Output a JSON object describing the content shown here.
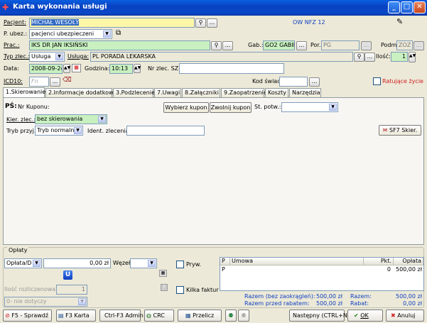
{
  "window": {
    "title": "Karta wykonania usługi",
    "minimize": "_",
    "maximize": "□",
    "close": "✕"
  },
  "header": {
    "pacjent_label": "Pacjent:",
    "pacjent_value": "MICHAŁ WESOŁY",
    "ow_label": "OW NFZ 12",
    "pubezp_label": "P. ubez.:",
    "pubezp_value": "pacjenci ubezpieczeni",
    "prac_label": "Prac.:",
    "prac_value": "IKS DR JAN IKSIŃSKI",
    "gab_label": "Gab.:",
    "gab_value": "GO2 GABIN",
    "por_label": "Por.",
    "por_value": "PG",
    "podm_label": "Podm.",
    "podm_value": "ZOZ",
    "typ_label": "Typ zlec.:",
    "typ_value": "Usługa",
    "usluga_label": "Usługa:",
    "usluga_value": "PL PORADA LEKARSKA",
    "ilosc_label": "Ilość:",
    "ilosc_value": "1",
    "data_label": "Data:",
    "data_value": "2008-09-24",
    "godzina_label": "Godzina:",
    "godzina_value": "10:13",
    "nrzlec_label": "Nr zlec. SZ:",
    "icd_label": "ICD10:",
    "icd_placeholder": "Fn",
    "kodswiad_label": "Kod świad.",
    "ratujace_label": "Ratujące życie",
    "dots": "..."
  },
  "tabs": [
    "1.Skierowanie",
    "2.Informacje dodatkowe",
    "3.Podzlecenie",
    "7.Uwagi",
    "8.Załączniki",
    "9.Zaopatrzenie",
    "Koszty",
    "Narzędzia"
  ],
  "skierowanie": {
    "ps_label": "PŚ:",
    "nrkuponu_label": "Nr Kuponu:",
    "wybierz_btn": "Wybierz kupon",
    "zwolnij_btn": "Zwolnij kupon",
    "stpotw_label": "St. potw.:",
    "kier_label": "Kier. zlec.:",
    "kier_value": "bez skierowania",
    "tryb_label": "Tryb przyj.:",
    "tryb_value": "Tryb normalny",
    "ident_label": "Ident. zlecenia:",
    "sf7_btn": "SF7 Skier."
  },
  "oplaty": {
    "group_label": "Opłaty",
    "typ_value": "Opłata/D",
    "kwota_value": "0,00 zł",
    "wezel_label": "Węzeł:",
    "u_btn": "U",
    "prywatnie_label": "Pryw.",
    "ilosc_rozl_label": "Ilość rozliczenowa:",
    "ilosc_rozl_value": "1",
    "nie_dotyczy": "0- nie dotyczy",
    "kilka_faktur_label": "Kilka faktur"
  },
  "grid": {
    "headers": [
      "P",
      "Umowa",
      "Pkt.",
      "Opłata"
    ],
    "row": {
      "p": "P",
      "umowa": "",
      "pkt": "0",
      "oplata": "500,00 zł"
    }
  },
  "totals": {
    "bez_zaokr_label": "Razem (bez zaokrągleń):",
    "bez_zaokr_value": "500,00 zł",
    "przed_rabatem_label": "Razem przed rabatem:",
    "przed_rabatem_value": "500,00 zł",
    "razem_label": "Razem:",
    "razem_value": "500,00 zł",
    "rabat_label": "Rabat:",
    "rabat_value": "0,00 zł"
  },
  "footer": {
    "f5": "F5 - Sprawdź",
    "f3": "F3 Karta",
    "ctrlf3": "Ctrl-F3 Admin",
    "crc": "CRC",
    "przelicz": "Przelicz",
    "nastepny": "Następny (CTRL+N)",
    "ok": "OK",
    "anuluj": "Anuluj"
  }
}
